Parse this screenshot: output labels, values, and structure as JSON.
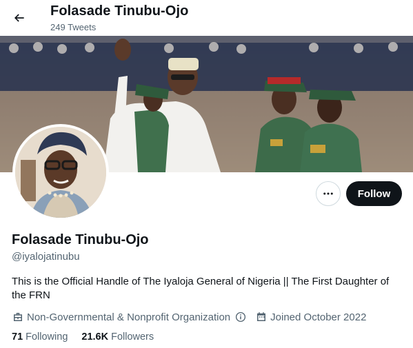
{
  "header": {
    "title": "Folasade Tinubu-Ojo",
    "tweet_count": "249 Tweets"
  },
  "profile": {
    "name": "Folasade Tinubu-Ojo",
    "handle": "@iyalojatinubu",
    "bio": "This is the Official Handle of The Iyaloja General of Nigeria || The First Daughter of the FRN",
    "category": "Non-Governmental & Nonprofit Organization",
    "joined": "Joined October 2022"
  },
  "stats": {
    "following_count": "71",
    "following_label": "Following",
    "followers_count": "21.6K",
    "followers_label": "Followers"
  },
  "actions": {
    "follow_label": "Follow",
    "more_glyph": "•••"
  },
  "icons": [
    "back-arrow-icon",
    "more-icon",
    "briefcase-icon",
    "info-icon",
    "calendar-icon"
  ],
  "colors": {
    "text_primary": "#0f1419",
    "text_secondary": "#536471",
    "follow_button": "#0f1419",
    "border": "#cfd9de"
  }
}
